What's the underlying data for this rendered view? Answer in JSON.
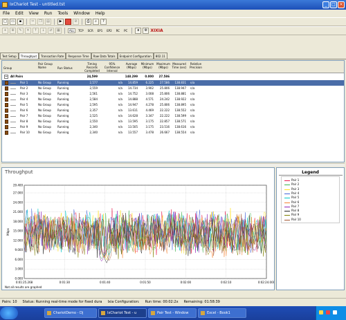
{
  "window": {
    "title": "IxChariot Test - untitled.tst"
  },
  "menu": [
    "File",
    "Edit",
    "View",
    "Run",
    "Tools",
    "Window",
    "Help"
  ],
  "pair_type_buttons": [
    "ALL",
    "TCP",
    "SCR",
    "EP1",
    "EP2",
    "RC",
    "PC"
  ],
  "brand": "XIXIA",
  "tabs": [
    "Test Setup",
    "Throughput",
    "Transaction Rate",
    "Response Time",
    "Raw Data Totals",
    "Endpoint Configuration",
    "802.11"
  ],
  "active_tab": "Throughput",
  "columns": {
    "group": "Group",
    "pair_group": "Pair Group Name",
    "run_status": "Run Status",
    "timing": "Timing Records Completed",
    "ci": "95% Confidence Interval",
    "avg": "Average (Mbps)",
    "min": "Minimum (Mbps)",
    "max": "Maximum (Mbps)",
    "time": "Measured Time (sec)",
    "rel": "Relative Precision"
  },
  "summary_row": {
    "label": "All Pairs",
    "timing": "24,599",
    "avg": "148.299",
    "min": "0.000",
    "max": "27.586"
  },
  "pairs": [
    {
      "name": "Pair 1",
      "group": "No Group",
      "status": "Running",
      "timing": "2,577",
      "ci": "n/a",
      "avg": "14.859",
      "min": "6.225",
      "max": "27.586",
      "time": "138.831",
      "rel": "n/a"
    },
    {
      "name": "Pair 2",
      "group": "No Group",
      "status": "Running",
      "timing": "2,559",
      "ci": "n/a",
      "avg": "14.734",
      "min": "3.902",
      "max": "25.806",
      "time": "138.947",
      "rel": "n/a"
    },
    {
      "name": "Pair 3",
      "group": "No Group",
      "status": "Running",
      "timing": "2,561",
      "ci": "n/a",
      "avg": "14.752",
      "min": "3.008",
      "max": "25.806",
      "time": "138.881",
      "rel": "n/a"
    },
    {
      "name": "Pair 4",
      "group": "No Group",
      "status": "Running",
      "timing": "2,584",
      "ci": "n/a",
      "avg": "14.888",
      "min": "4.571",
      "max": "24.242",
      "time": "138.922",
      "rel": "n/a"
    },
    {
      "name": "Pair 5",
      "group": "No Group",
      "status": "Running",
      "timing": "2,595",
      "ci": "n/a",
      "avg": "14.947",
      "min": "4.278",
      "max": "25.806",
      "time": "138.895",
      "rel": "n/a"
    },
    {
      "name": "Pair 6",
      "group": "No Group",
      "status": "Running",
      "timing": "2,357",
      "ci": "n/a",
      "avg": "13.611",
      "min": "4.469",
      "max": "22.222",
      "time": "138.552",
      "rel": "n/a"
    },
    {
      "name": "Pair 7",
      "group": "No Group",
      "status": "Running",
      "timing": "2,525",
      "ci": "n/a",
      "avg": "14.628",
      "min": "3.347",
      "max": "22.222",
      "time": "138.599",
      "rel": "n/a"
    },
    {
      "name": "Pair 8",
      "group": "No Group",
      "status": "Running",
      "timing": "2,550",
      "ci": "n/a",
      "avg": "13.595",
      "min": "3.175",
      "max": "22.857",
      "time": "138.571",
      "rel": "n/a"
    },
    {
      "name": "Pair 9",
      "group": "No Group",
      "status": "Running",
      "timing": "2,340",
      "ci": "n/a",
      "avg": "13.505",
      "min": "3.175",
      "max": "23.516",
      "time": "138.616",
      "rel": "n/a"
    },
    {
      "name": "Pair 10",
      "group": "No Group",
      "status": "Running",
      "timing": "2,340",
      "ci": "n/a",
      "avg": "13.557",
      "min": "3.478",
      "max": "26.667",
      "time": "138.554",
      "rel": "n/a"
    }
  ],
  "chart_panel": {
    "title": "Throughput",
    "note": "Not all results are graphed"
  },
  "chart_data": {
    "type": "line",
    "ylabel": "Mbps",
    "xlabel": "Elapsed time (h:mm:ss)",
    "ylim": [
      0.0,
      29.4
    ],
    "yticks": [
      "29.400",
      "27.000",
      "24.000",
      "21.000",
      "18.000",
      "15.000",
      "12.000",
      "9.000",
      "6.000",
      "3.000",
      "0.000"
    ],
    "xticks": [
      "0:01:25.268",
      "0:01:30",
      "0:01:40",
      "0:01:50",
      "0:02:00",
      "0:02:10",
      "0:02:24.000"
    ],
    "grid": true,
    "series": [
      {
        "name": "Pair 1",
        "color": "#e6194b",
        "mean": 14.86,
        "dips": [
          [
            0.33,
            7.5
          ]
        ]
      },
      {
        "name": "Pair 2",
        "color": "#3cb44b",
        "mean": 14.73,
        "dips": [
          [
            0.32,
            6.0
          ]
        ]
      },
      {
        "name": "Pair 3",
        "color": "#ffe119",
        "mean": 14.75,
        "dips": [
          [
            0.34,
            5.8
          ]
        ]
      },
      {
        "name": "Pair 4",
        "color": "#4363d8",
        "mean": 14.89,
        "dips": [
          [
            0.33,
            6.9
          ],
          [
            0.76,
            9.0
          ]
        ]
      },
      {
        "name": "Pair 5",
        "color": "#00c8c8",
        "mean": 14.95,
        "dips": [
          [
            0.35,
            7.2
          ]
        ]
      },
      {
        "name": "Pair 6",
        "color": "#f58231",
        "mean": 13.61,
        "dips": [
          [
            0.33,
            6.2
          ],
          [
            0.77,
            8.0
          ]
        ]
      },
      {
        "name": "Pair 7",
        "color": "#911eb4",
        "mean": 14.63,
        "dips": [
          [
            0.32,
            5.2
          ],
          [
            0.95,
            8.5
          ]
        ]
      },
      {
        "name": "Pair 8",
        "color": "#222222",
        "mean": 13.6,
        "dips": [
          [
            0.34,
            4.8
          ]
        ]
      },
      {
        "name": "Pair 9",
        "color": "#808000",
        "mean": 13.51,
        "dips": [
          [
            0.33,
            6.5
          ],
          [
            0.76,
            7.5
          ]
        ]
      },
      {
        "name": "Pair 10",
        "color": "#a0522d",
        "mean": 13.56,
        "dips": [
          [
            0.35,
            5.5
          ]
        ]
      }
    ]
  },
  "legend": {
    "title": "Legend"
  },
  "status": {
    "pairs": "Pairs: 10",
    "run": "Status: Running real-time mode for fixed dura",
    "ixia": "Ixia Configuration:",
    "run_time": "Run time: 00:02:2x",
    "remaining": "Remaining: 01:58:39"
  },
  "taskbar": {
    "tasks": [
      "ChariotDemo - Dj",
      "IxChariot Test - u",
      "Pair Test - Window",
      "Excel - Book1"
    ]
  }
}
